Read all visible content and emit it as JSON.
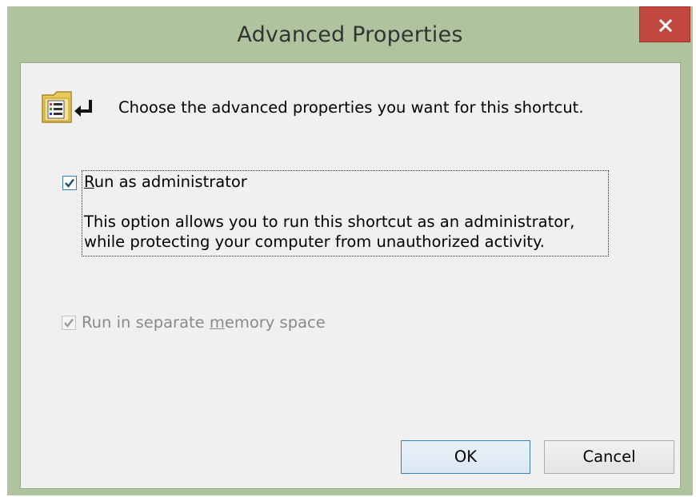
{
  "window": {
    "title": "Advanced Properties",
    "close_label": "✕"
  },
  "content": {
    "intro": "Choose the advanced properties you want for this shortcut.",
    "icon": "shortcut-folder-icon"
  },
  "run_as_admin": {
    "label_access_key": "R",
    "label_rest": "un as administrator",
    "checked": true,
    "description_line1": "This option allows you to run this shortcut as an administrator,",
    "description_line2": "while protecting your computer from unauthorized activity."
  },
  "separate_memory": {
    "label_before": "Run in separate ",
    "label_access_key": "m",
    "label_after": "emory space",
    "checked": true,
    "enabled": false
  },
  "buttons": {
    "ok": "OK",
    "cancel": "Cancel"
  },
  "colors": {
    "frame": "#aec39e",
    "close": "#c2473f",
    "client": "#f0f0f0",
    "focus_border": "#3c7fb1",
    "disabled_text": "#8a8a8a"
  }
}
